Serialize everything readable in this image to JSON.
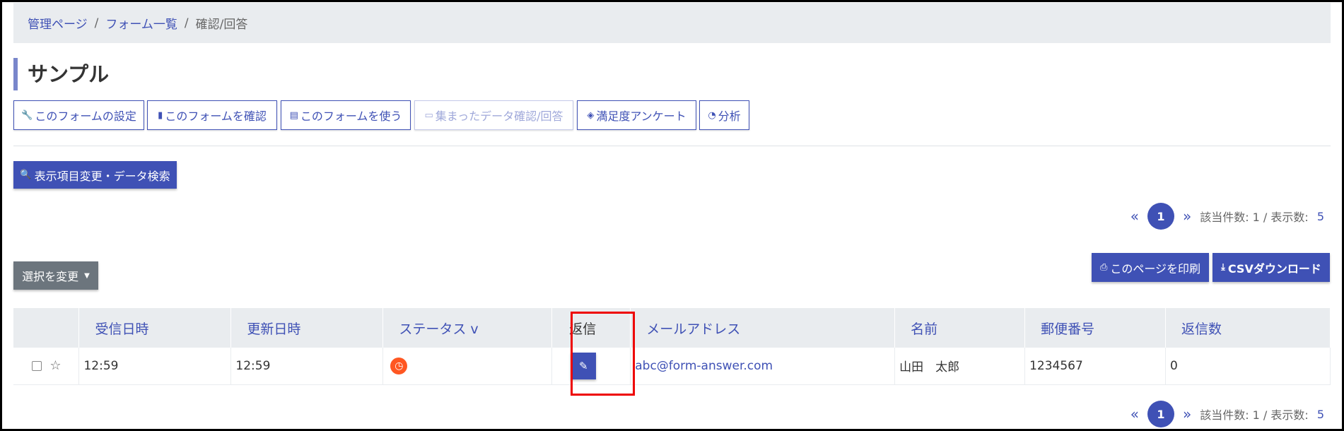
{
  "breadcrumb": {
    "home": "管理ページ",
    "forms": "フォーム一覧",
    "current": "確認/回答"
  },
  "page_title": "サンプル",
  "nav_buttons": [
    {
      "label": "このフォームの設定",
      "icon": "wrench-icon",
      "glyph": "🔧"
    },
    {
      "label": "このフォームを確認",
      "icon": "document-icon",
      "glyph": "▮"
    },
    {
      "label": "このフォームを使う",
      "icon": "document-lines-icon",
      "glyph": "▤"
    },
    {
      "label": "集まったデータ確認/回答",
      "icon": "comment-icon",
      "glyph": "▭"
    },
    {
      "label": "満足度アンケート",
      "icon": "layers-icon",
      "glyph": "◈"
    },
    {
      "label": "分析",
      "icon": "pie-chart-icon",
      "glyph": "◔"
    }
  ],
  "search_button": {
    "label": "表示項目変更・データ検索",
    "icon": "search-icon",
    "glyph": "🔍"
  },
  "pagination": {
    "prev": "«",
    "page": "1",
    "next": "»",
    "info": "該当件数: 1 / 表示数:",
    "per_page": "5"
  },
  "select_button": {
    "label": "選択を変更",
    "caret": "▼"
  },
  "print_button": {
    "label": "このページを印刷",
    "icon": "print-icon",
    "glyph": "⎙"
  },
  "csv_button": {
    "label": "CSVダウンロード",
    "icon": "download-icon",
    "glyph": "⤓"
  },
  "table": {
    "headers": {
      "received": "受信日時",
      "updated": "更新日時",
      "status": "ステータス v",
      "reply": "返信",
      "email": "メールアドレス",
      "name": "名前",
      "postal": "郵便番号",
      "reply_count": "返信数"
    },
    "rows": [
      {
        "star": "☆",
        "received": "12:59",
        "updated": "12:59",
        "status_icon": "clock-icon",
        "status_glyph": "◷",
        "reply_icon": "pencil-icon",
        "reply_glyph": "✎",
        "email": "abc@form-answer.com",
        "name": "山田　太郎",
        "postal": "1234567",
        "reply_count": "0"
      }
    ]
  },
  "colors": {
    "primary": "#3f51b5",
    "secondary": "#6c757d",
    "status_orange": "#ff5722",
    "highlight_red": "#ee0000",
    "breadcrumb_bg": "#e9ecef"
  }
}
